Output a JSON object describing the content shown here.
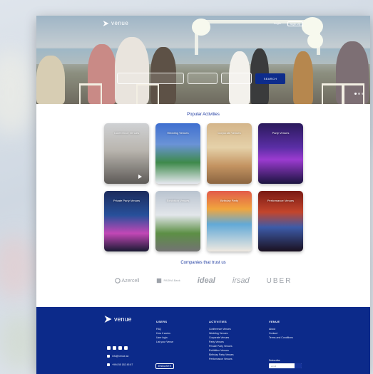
{
  "brand": {
    "name": "venue",
    "primary_color": "#0c2a8a",
    "accent_color": "#1d3aa0"
  },
  "header": {
    "login_label": "Login",
    "signup_label": "Sign Up"
  },
  "hero": {
    "search_button": "SEARCH",
    "slides_total": 3,
    "active_slide": 1
  },
  "popular": {
    "title": "Popular Activities",
    "tiles": [
      {
        "label": "Conference Venues",
        "icon": "play-icon"
      },
      {
        "label": "Wedding Venues"
      },
      {
        "label": "Corporate Venues"
      },
      {
        "label": "Party Venues"
      },
      {
        "label": "Private Party Venues"
      },
      {
        "label": "Exhibition Venues"
      },
      {
        "label": "Birthday Party"
      },
      {
        "label": "Performance Venues"
      }
    ]
  },
  "companies": {
    "title": "Companies that trust us",
    "logos": [
      "Azercell",
      "PASHA Bank",
      "ideal",
      "irsad",
      "UBER"
    ]
  },
  "footer": {
    "users": {
      "title": "USERS",
      "links": [
        "FAQ",
        "How it works",
        "User login",
        "List your Venue"
      ]
    },
    "activities": {
      "title": "ACTIVITIES",
      "links": [
        "Conference Venues",
        "Wedding Venues",
        "Corporate Venues",
        "Party Venues",
        "Private Party Venues",
        "Exhibition Venues",
        "Birthday Party Venues",
        "Performance Venues"
      ]
    },
    "venue": {
      "title": "VENUE",
      "links": [
        "About",
        "Contact",
        "Terms and Conditions"
      ]
    },
    "email": "info@venue.az",
    "phone": "+994 55 182 45 67",
    "language": "ENGLISH",
    "subscribe_label": "Subscribe",
    "subscribe_placeholder": "email",
    "social_icons": [
      "facebook-icon",
      "instagram-icon",
      "twitter-icon",
      "linkedin-icon"
    ]
  }
}
